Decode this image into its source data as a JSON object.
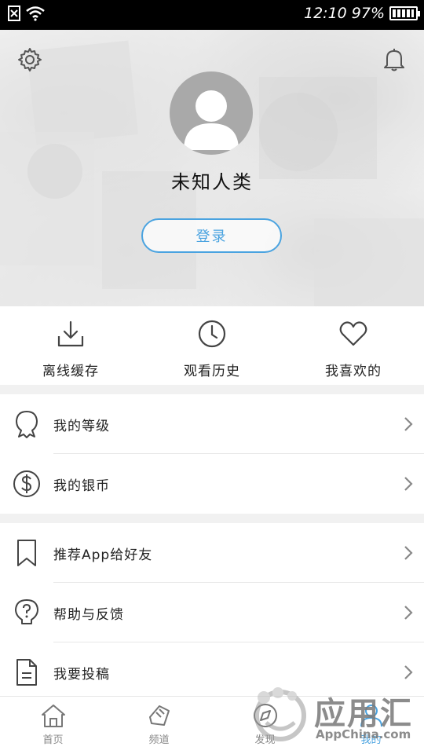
{
  "status_bar": {
    "time": "12:10",
    "battery": "97%",
    "battery_level": 0.97
  },
  "header": {
    "username": "未知人类",
    "login_label": "登录",
    "settings_icon": "gear-icon",
    "notification_icon": "bell-icon"
  },
  "quick_actions": [
    {
      "label": "离线缓存",
      "icon": "download-icon"
    },
    {
      "label": "观看历史",
      "icon": "clock-icon"
    },
    {
      "label": "我喜欢的",
      "icon": "heart-icon"
    }
  ],
  "menu_group_1": [
    {
      "label": "我的等级",
      "icon": "badge-icon"
    },
    {
      "label": "我的银币",
      "icon": "coin-icon"
    }
  ],
  "menu_group_2": [
    {
      "label": "推荐App给好友",
      "icon": "bookmark-icon"
    },
    {
      "label": "帮助与反馈",
      "icon": "help-bulb-icon"
    },
    {
      "label": "我要投稿",
      "icon": "document-icon"
    }
  ],
  "tabs": [
    {
      "label": "首页",
      "icon": "home-icon",
      "active": false
    },
    {
      "label": "频道",
      "icon": "channel-icon",
      "active": false
    },
    {
      "label": "发现",
      "icon": "discover-icon",
      "active": false
    },
    {
      "label": "我的",
      "icon": "profile-icon",
      "active": true
    }
  ],
  "watermark": {
    "title": "应用汇",
    "subtitle": "AppChina.com"
  },
  "colors": {
    "accent": "#4aa3e0",
    "status_bar": "#000000",
    "divider_gap": "#f1f1f1"
  }
}
